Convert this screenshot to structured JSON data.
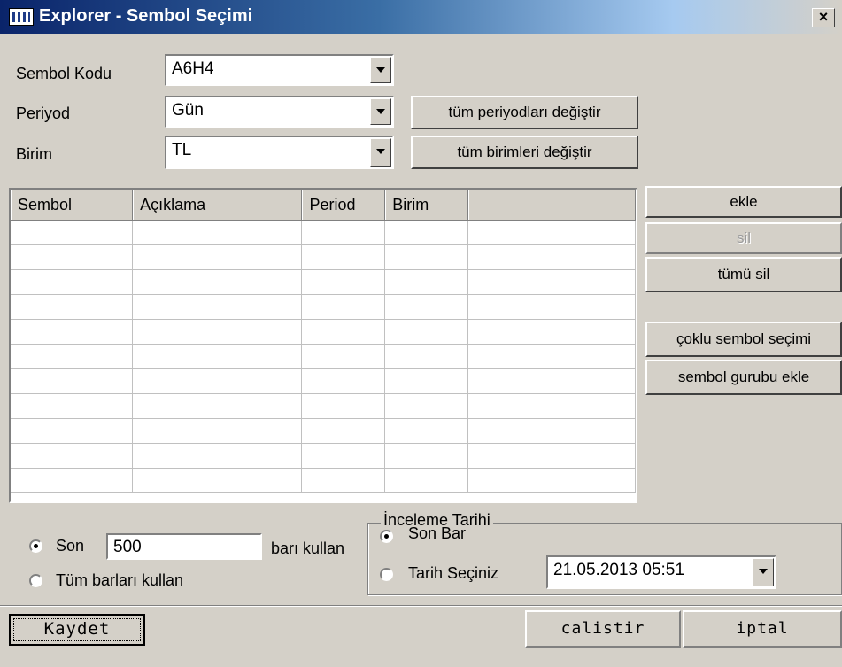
{
  "window": {
    "title": "Explorer - Sembol Seçimi",
    "close_glyph": "×"
  },
  "form": {
    "symbol_code": {
      "label": "Sembol Kodu",
      "value": "A6H4"
    },
    "period": {
      "label": "Periyod",
      "value": "Gün",
      "button": "tüm periyodları değiştir"
    },
    "unit": {
      "label": "Birim",
      "value": "TL",
      "button": "tüm birimleri değiştir"
    }
  },
  "table": {
    "columns": [
      "Sembol",
      "Açıklama",
      "Period",
      "Birim",
      ""
    ],
    "rows": []
  },
  "side_buttons": {
    "add": "ekle",
    "delete": "sil",
    "delete_all": "tümü sil",
    "multi_select": "çoklu sembol seçimi",
    "add_group": "sembol gurubu ekle"
  },
  "bars": {
    "last_label": "Son",
    "last_value": "500",
    "suffix": "barı kullan",
    "all_label": "Tüm barları kullan",
    "selected": "last"
  },
  "review_date": {
    "legend": "İnceleme Tarihi",
    "last_bar": "Son Bar",
    "choose_date": "Tarih Seçiniz",
    "date_value": "21.05.2013 05:51",
    "selected": "last_bar"
  },
  "footer": {
    "save": "Kaydet",
    "run": "calistir",
    "cancel": "iptal"
  }
}
